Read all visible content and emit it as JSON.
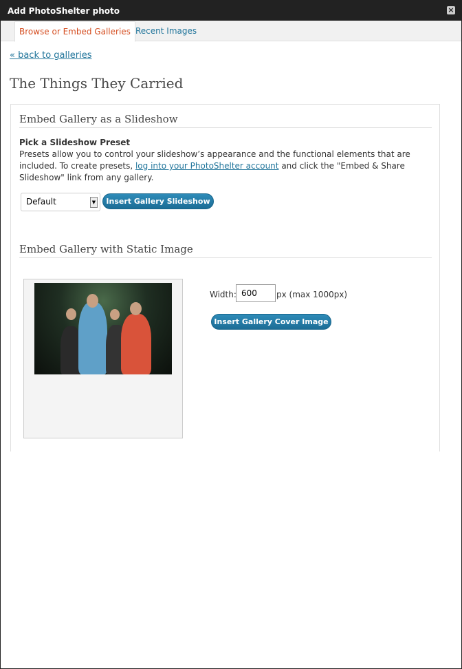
{
  "window": {
    "title": "Add PhotoShelter photo",
    "close_glyph": "×"
  },
  "tabs": [
    {
      "label": "Browse or Embed Galleries",
      "active": true
    },
    {
      "label": "Recent Images",
      "active": false
    }
  ],
  "back_link": "« back to galleries",
  "page_title": "The Things They Carried",
  "slideshow": {
    "section_title": "Embed Gallery as a Slideshow",
    "heading": "Pick a Slideshow Preset",
    "desc_before": "Presets allow you to control your slideshow’s appearance and the functional elements that are included. To create presets, ",
    "desc_link": "log into your PhotoShelter account",
    "desc_after": " and click the \"Embed & Share Slideshow\" link from any gallery.",
    "preset_selected": "Default",
    "insert_button": "Insert Gallery Slideshow"
  },
  "static": {
    "section_title": "Embed Gallery with Static Image",
    "width_label": "Width:",
    "width_value": "600",
    "width_suffix": "px (max 1000px)",
    "insert_button": "Insert Gallery Cover Image"
  },
  "colors": {
    "accent": "#21759b",
    "active_tab": "#d54e21",
    "button": "#1c6d96"
  }
}
